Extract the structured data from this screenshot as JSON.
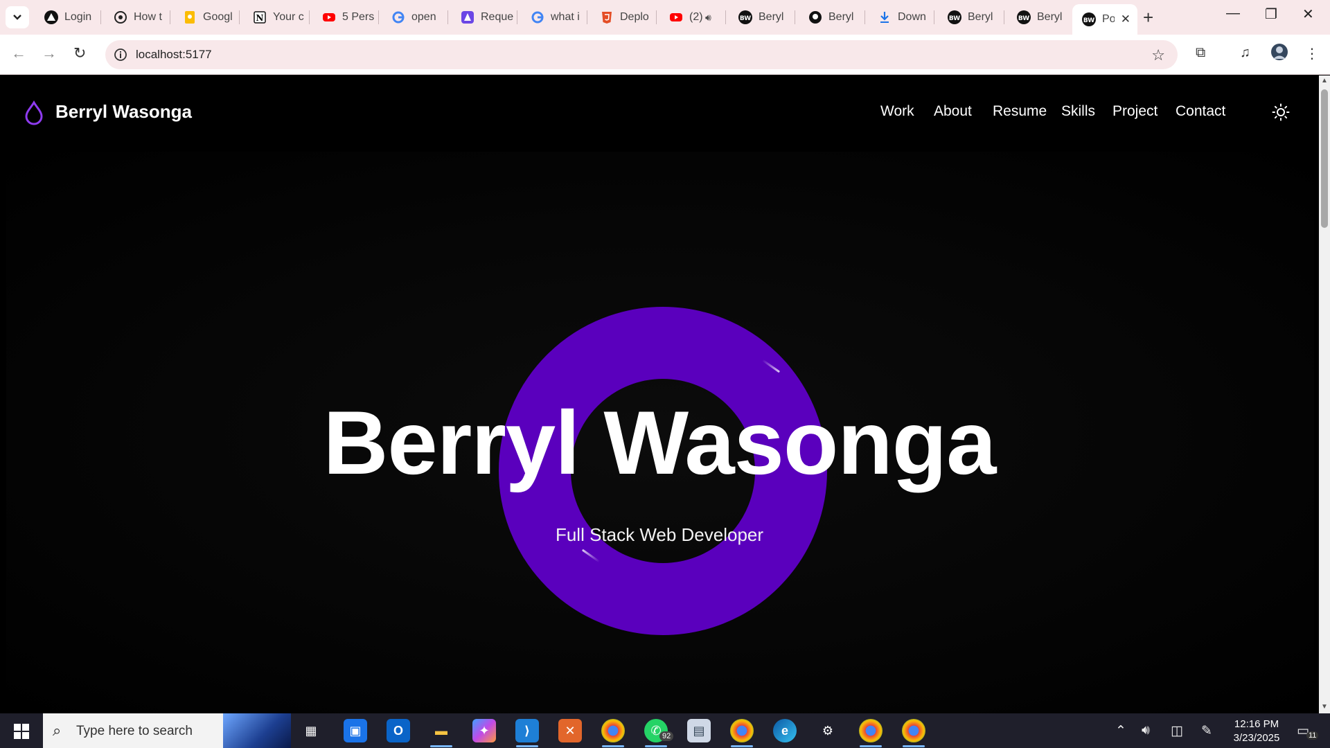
{
  "browser": {
    "tabs": [
      {
        "title": "Login",
        "icon": "triangle-logo-icon"
      },
      {
        "title": "How t",
        "icon": "openai-icon"
      },
      {
        "title": "Googl",
        "icon": "google-keep-icon"
      },
      {
        "title": "Your c",
        "icon": "notion-icon"
      },
      {
        "title": "5 Pers",
        "icon": "youtube-icon"
      },
      {
        "title": "open",
        "icon": "google-icon"
      },
      {
        "title": "Reque",
        "icon": "app-logo-icon"
      },
      {
        "title": "what i",
        "icon": "google-icon"
      },
      {
        "title": "Deplo",
        "icon": "html5-icon"
      },
      {
        "title": "(2)",
        "icon": "youtube-icon"
      },
      {
        "title": "Beryl",
        "icon": "bw-icon"
      },
      {
        "title": "Beryl",
        "icon": "github-icon"
      },
      {
        "title": "Down",
        "icon": "download-icon"
      },
      {
        "title": "Beryl",
        "icon": "bw-icon"
      },
      {
        "title": "Beryl",
        "icon": "bw-icon"
      }
    ],
    "active_tab": {
      "title": "Po",
      "icon": "bw-icon"
    },
    "url": "localhost:5177",
    "favicon_text": "BW"
  },
  "site": {
    "brand": "Berryl Wasonga",
    "nav": [
      "Work",
      "About",
      "Resume",
      "Skills",
      "Project",
      "Contact"
    ],
    "accent": "#5a00bd"
  },
  "hero": {
    "title": "Berryl Wasonga",
    "subtitle": "Full Stack Web Developer"
  },
  "taskbar": {
    "search_placeholder": "Type here to search",
    "whatsapp_badge": "92",
    "notification_count": "11",
    "time": "12:16 PM",
    "date": "3/23/2025"
  }
}
